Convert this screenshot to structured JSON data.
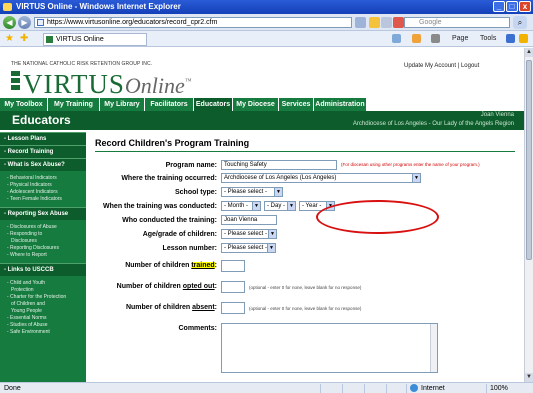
{
  "window": {
    "title": "VIRTUS Online - Windows Internet Explorer",
    "controls": [
      "_",
      "□",
      "x"
    ]
  },
  "address_bar": {
    "url": "https://www.virtusonline.org/educators/record_cpr2.cfm",
    "search_placeholder": "Google"
  },
  "favorites_bar": {
    "tab_label": "VIRTUS Online",
    "page_label": "Page",
    "tools_label": "Tools"
  },
  "header": {
    "org_line": "THE NATIONAL CATHOLIC RISK RETENTION GROUP INC.",
    "logo_main": "VIRTUS",
    "logo_italic": "Online",
    "logo_tm": "™",
    "update_account": "Update My Account",
    "separator": "|",
    "logout": "Logout"
  },
  "nav_tabs": [
    "My Toolbox",
    "My Training",
    "My Library",
    "Facilitators",
    "Educators",
    "My Diocese",
    "Services",
    "Administration"
  ],
  "active_tab": "Educators",
  "banner": {
    "section_title": "Educators",
    "user_name": "Joan Vienna",
    "user_location": "Archdiocese of Los Angeles - Our Lady of the Angels Region"
  },
  "sidebar": {
    "lesson_plans": "- Lesson Plans",
    "record_training": "- Record Training",
    "what_is_sex_abuse": "- What is Sex Abuse?",
    "abuse_items": [
      "- Behavioral Indicators",
      "- Physical Indicators",
      "- Adolescent Indicators",
      "- Teen Female Indicators"
    ],
    "reporting": "- Reporting Sex Abuse",
    "reporting_items": [
      "- Disclosures of Abuse",
      "- Responding to",
      "Disclosures",
      "- Reporting Disclosures",
      "- Where to Report"
    ],
    "usccb": "- Links to USCCB",
    "usccb_items": [
      "- Child and Youth",
      "Protection",
      "- Charter for the Protection",
      "of Children and",
      "Young People",
      "- Essential Norms",
      "- Studies of Abuse",
      "- Safe Environment"
    ]
  },
  "form": {
    "page_heading": "Record Children's Program Training",
    "program_name_label": "Program name:",
    "program_name_value": "Touching Safety",
    "program_name_note": "(For diocesan using other programs enter the name of your program.)",
    "where_label": "Where the training occurred:",
    "where_value": "Archdiocese of Los Angeles (Los Angeles)",
    "school_type_label": "School type:",
    "school_type_value": "- Please select -",
    "when_label": "When the training was conducted:",
    "month_value": "- Month -",
    "day_value": "- Day -",
    "year_value": "- Year -",
    "who_label": "Who conducted the training:",
    "who_value": "Joan Vienna",
    "age_label": "Age/grade of children:",
    "age_value": "- Please select -",
    "lesson_label": "Lesson number:",
    "lesson_value": "- Please select -",
    "trained_label_pre": "Number of children ",
    "trained_label_word": "trained",
    "trained_label_post": ":",
    "opted_label_pre": "Number of children ",
    "opted_label_word": "opted out",
    "opted_label_post": ":",
    "opted_note": "(optional - enter 0 for none, leave blank for no response)",
    "absent_label_pre": "Number of children ",
    "absent_label_word": "absent",
    "absent_label_post": ":",
    "absent_note": "(optional - enter 0 for none, leave blank for no response)",
    "comments_label": "Comments:"
  },
  "status_bar": {
    "status": "Done",
    "zone": "Internet",
    "zoom": "100%"
  },
  "colors": {
    "brand_green": "#157b3e",
    "dark_green": "#0d5c2b",
    "annotation_red": "#d91010",
    "highlight_yellow": "#ffff00"
  }
}
